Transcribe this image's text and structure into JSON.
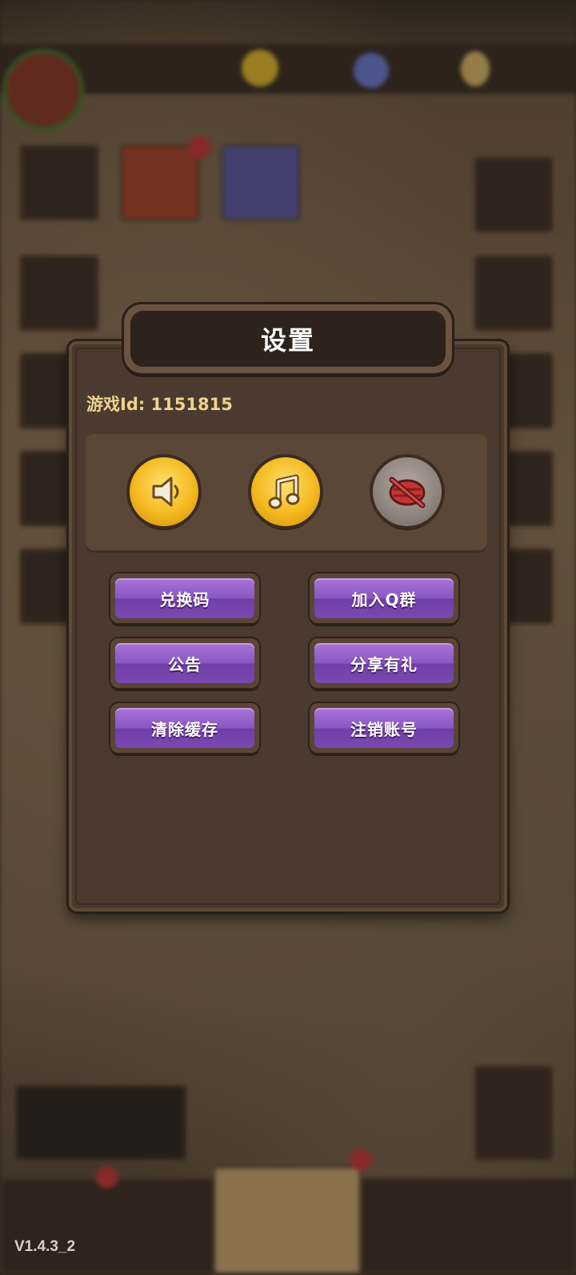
{
  "dialog": {
    "title": "设置",
    "game_id_label": "游戏Id: 1151815",
    "audio_controls": [
      {
        "name": "sound",
        "icon": "speaker-icon",
        "state": "on"
      },
      {
        "name": "music",
        "icon": "music-note-icon",
        "state": "on"
      },
      {
        "name": "vibration",
        "icon": "vibration-off-icon",
        "state": "off"
      }
    ],
    "buttons": {
      "redeem_code": "兑换码",
      "join_qq_group": "加入Q群",
      "announcement": "公告",
      "share_gift": "分享有礼",
      "clear_cache": "清除缓存",
      "delete_account": "注销账号"
    }
  },
  "version": "V1.4.3_2",
  "colors": {
    "button_purple": "#8a56c2",
    "icon_gold": "#f4b91f",
    "panel_brown": "#4b3a2f",
    "id_text": "#f1d28f"
  }
}
